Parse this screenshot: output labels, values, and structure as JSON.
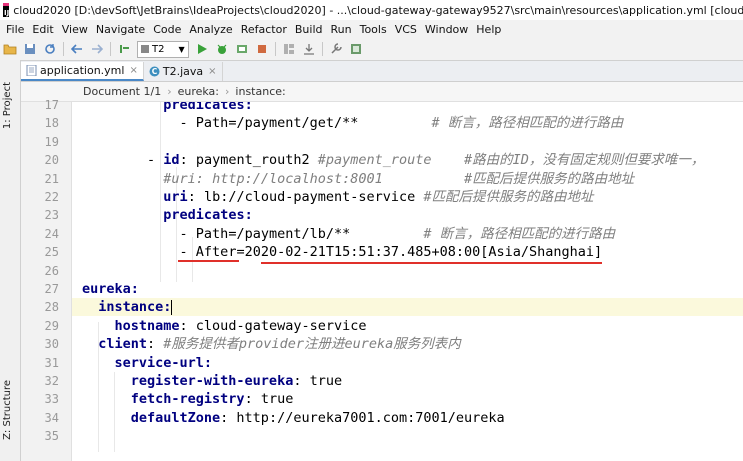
{
  "window": {
    "title": "cloud2020 [D:\\devSoft\\JetBrains\\IdeaProjects\\cloud2020] - ...\\cloud-gateway-gateway9527\\src\\main\\resources\\application.yml [cloud-gateway-gatew",
    "app_icon_text": "IJ"
  },
  "menu": [
    "File",
    "Edit",
    "View",
    "Navigate",
    "Code",
    "Analyze",
    "Refactor",
    "Build",
    "Run",
    "Tools",
    "VCS",
    "Window",
    "Help"
  ],
  "toolbar": {
    "run_config": "T2"
  },
  "sidebar": {
    "project_tab": "1: Project",
    "structure_tab": "Z: Structure"
  },
  "tabs": [
    {
      "label": "application.yml",
      "icon": "yml-file-icon",
      "active": true
    },
    {
      "label": "T2.java",
      "icon": "java-class-icon",
      "active": false
    }
  ],
  "breadcrumb": [
    "Document 1/1",
    "eureka:",
    "instance:"
  ],
  "editor": {
    "current_line": 28,
    "lines": [
      {
        "n": 17,
        "indent": 10,
        "segs": [
          {
            "t": "predicates:",
            "c": "key"
          }
        ]
      },
      {
        "n": 18,
        "indent": 12,
        "segs": [
          {
            "t": "- Path=/payment/get/**         ",
            "c": "str"
          },
          {
            "t": "# 断言，路径相匹配的进行路由",
            "c": "cm"
          }
        ]
      },
      {
        "n": 19,
        "indent": 0,
        "segs": []
      },
      {
        "n": 20,
        "indent": 8,
        "segs": [
          {
            "t": "- ",
            "c": "str"
          },
          {
            "t": "id",
            "c": "key"
          },
          {
            "t": ": payment_routh2 ",
            "c": "str"
          },
          {
            "t": "#payment_route    #路由的ID，没有固定规则但要求唯一，",
            "c": "cm"
          }
        ]
      },
      {
        "n": 21,
        "indent": 10,
        "segs": [
          {
            "t": "#uri: http://localhost:8001          #匹配后提供服务的路由地址",
            "c": "cm"
          }
        ]
      },
      {
        "n": 22,
        "indent": 10,
        "segs": [
          {
            "t": "uri",
            "c": "key"
          },
          {
            "t": ": lb://cloud-payment-service ",
            "c": "str"
          },
          {
            "t": "#匹配后提供服务的路由地址",
            "c": "cm"
          }
        ]
      },
      {
        "n": 23,
        "indent": 10,
        "segs": [
          {
            "t": "predicates:",
            "c": "key"
          }
        ]
      },
      {
        "n": 24,
        "indent": 12,
        "segs": [
          {
            "t": "- Path=/payment/lb/**         ",
            "c": "str"
          },
          {
            "t": "# 断言，路径相匹配的进行路由",
            "c": "cm"
          }
        ]
      },
      {
        "n": 25,
        "indent": 12,
        "segs": [
          {
            "t": "- After=2020-02-21T15:51:37.485+08:00[Asia/Shanghai]",
            "c": "str"
          }
        ]
      },
      {
        "n": 26,
        "indent": 0,
        "segs": []
      },
      {
        "n": 27,
        "indent": 0,
        "segs": [
          {
            "t": "eureka:",
            "c": "key"
          }
        ]
      },
      {
        "n": 28,
        "indent": 2,
        "segs": [
          {
            "t": "instance:",
            "c": "key"
          }
        ]
      },
      {
        "n": 29,
        "indent": 4,
        "segs": [
          {
            "t": "hostname",
            "c": "key"
          },
          {
            "t": ": cloud-gateway-service",
            "c": "str"
          }
        ]
      },
      {
        "n": 30,
        "indent": 2,
        "segs": [
          {
            "t": "client",
            "c": "key"
          },
          {
            "t": ": ",
            "c": "str"
          },
          {
            "t": "#服务提供者provider注册进eureka服务列表内",
            "c": "cm"
          }
        ]
      },
      {
        "n": 31,
        "indent": 4,
        "segs": [
          {
            "t": "service-url:",
            "c": "key"
          }
        ]
      },
      {
        "n": 32,
        "indent": 6,
        "segs": [
          {
            "t": "register-with-eureka",
            "c": "key"
          },
          {
            "t": ": true",
            "c": "str"
          }
        ]
      },
      {
        "n": 33,
        "indent": 6,
        "segs": [
          {
            "t": "fetch-registry",
            "c": "key"
          },
          {
            "t": ": true",
            "c": "str"
          }
        ]
      },
      {
        "n": 34,
        "indent": 6,
        "segs": [
          {
            "t": "defaultZone",
            "c": "key"
          },
          {
            "t": ": http://eureka7001.com:7001/eureka",
            "c": "str"
          }
        ]
      },
      {
        "n": 35,
        "indent": 0,
        "segs": []
      }
    ]
  }
}
